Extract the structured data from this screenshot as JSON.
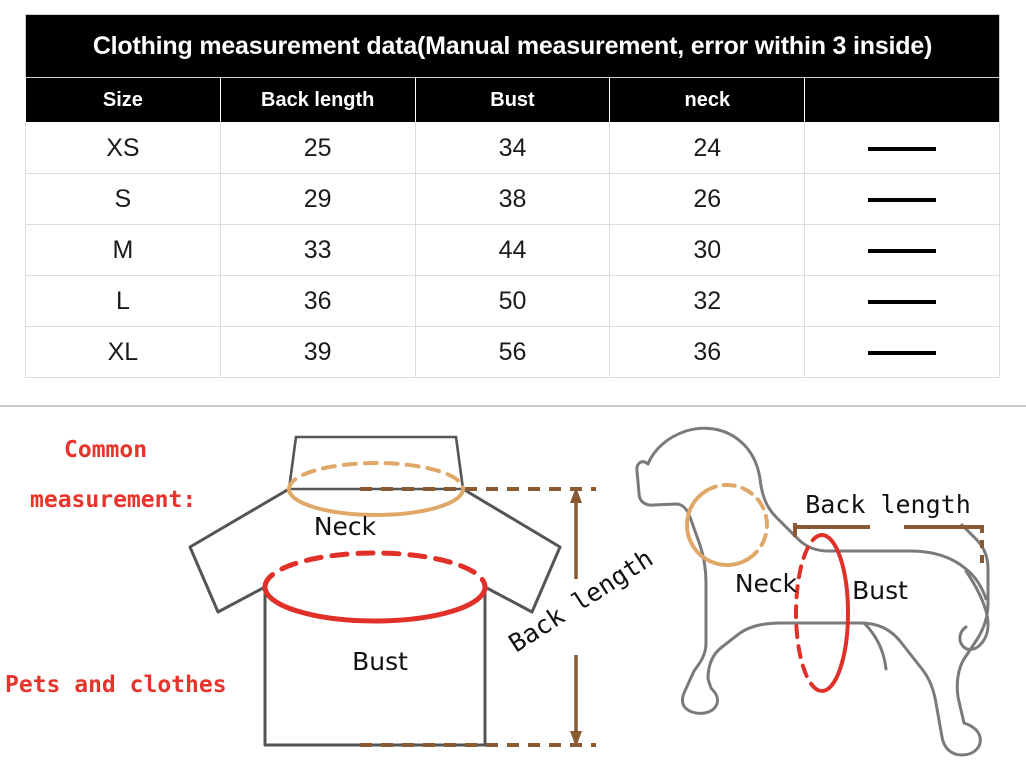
{
  "table": {
    "title": "Clothing measurement data(Manual measurement, error within 3 inside)",
    "columns": [
      "Size",
      "Back length",
      "Bust",
      "neck",
      ""
    ],
    "rows": [
      {
        "size": "XS",
        "back_length": "25",
        "bust": "34",
        "neck": "24",
        "extra": "—"
      },
      {
        "size": "S",
        "back_length": "29",
        "bust": "38",
        "neck": "26",
        "extra": "—"
      },
      {
        "size": "M",
        "back_length": "33",
        "bust": "44",
        "neck": "30",
        "extra": "—"
      },
      {
        "size": "L",
        "back_length": "36",
        "bust": "50",
        "neck": "32",
        "extra": "—"
      },
      {
        "size": "XL",
        "back_length": "39",
        "bust": "56",
        "neck": "36",
        "extra": "—"
      }
    ]
  },
  "diagram": {
    "note_line1": "Common",
    "note_line2": "measurement:",
    "note_line3": "Pets and clothes",
    "shirt": {
      "neck_label": "Neck",
      "bust_label": "Bust",
      "back_length_label": "Back length"
    },
    "dog": {
      "neck_label": "Neck",
      "bust_label": "Bust",
      "back_length_label": "Back length"
    }
  },
  "colors": {
    "header_bg": "#000000",
    "header_text": "#ffffff",
    "neck_ellipse": "#e0a868",
    "bust_ellipse": "#e03028",
    "dimension_brown": "#8a5a33",
    "outline_gray": "#555555",
    "note_red": "#e8342c",
    "grid_line": "#dcdcdc"
  }
}
